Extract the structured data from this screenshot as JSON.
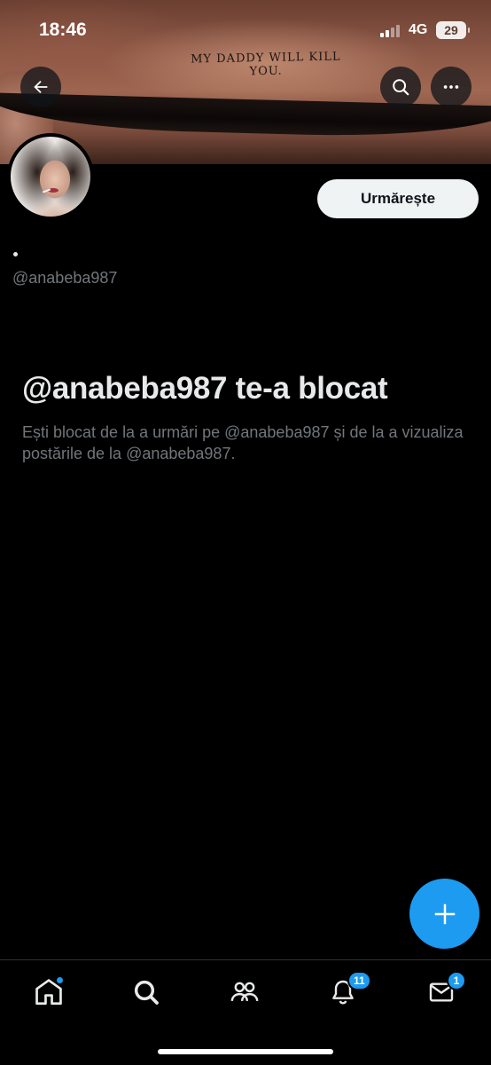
{
  "status_bar": {
    "time": "18:46",
    "network": "4G",
    "battery": "29"
  },
  "banner": {
    "tattoo_text": "MY DADDY WILL KILL YOU."
  },
  "profile": {
    "display_name": "•",
    "handle": "@anabeba987",
    "follow_label": "Urmărește"
  },
  "blocked": {
    "title": "@anabeba987 te-a blocat",
    "description": "Ești blocat de la a urmări pe @anabeba987 și de la a vizualiza postările de la @anabeba987."
  },
  "bottom_nav": {
    "items": [
      {
        "icon": "home-icon",
        "badge": "dot"
      },
      {
        "icon": "search-icon"
      },
      {
        "icon": "communities-icon"
      },
      {
        "icon": "bell-icon",
        "badge": "11"
      },
      {
        "icon": "mail-icon",
        "badge": "1"
      }
    ]
  },
  "colors": {
    "accent": "#1d9bf0",
    "background": "#000000",
    "secondary_text": "#71767b",
    "primary_text": "#e7e9ea"
  }
}
